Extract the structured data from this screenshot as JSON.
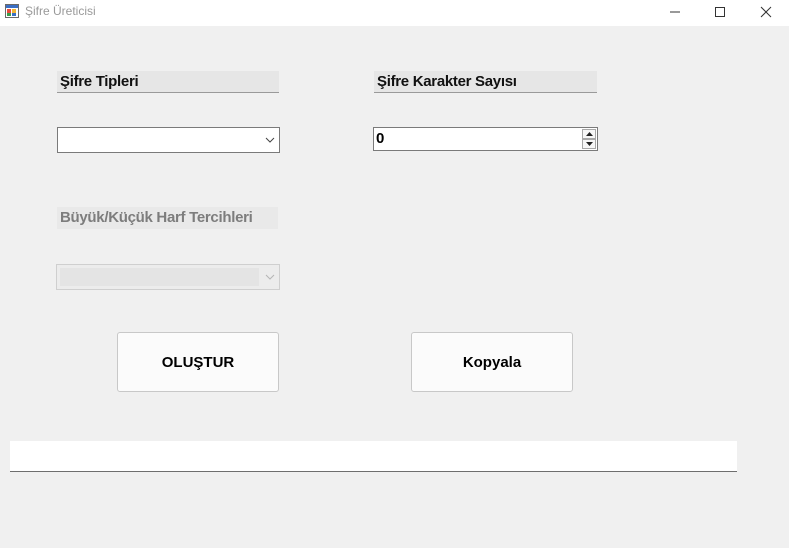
{
  "window": {
    "title": "Şifre Üreticisi"
  },
  "labels": {
    "password_types": "Şifre Tipleri",
    "char_count": "Şifre Karakter Sayısı",
    "case_preferences": "Büyük/Küçük Harf Tercihleri"
  },
  "inputs": {
    "password_type_value": "",
    "char_count_value": "0",
    "case_preference_value": "",
    "output_value": ""
  },
  "buttons": {
    "create": "OLUŞTUR",
    "copy": "Kopyala"
  },
  "icons": {
    "app": "app-window-icon",
    "minimize": "minimize-icon",
    "maximize": "maximize-icon",
    "close": "close-icon",
    "dropdown": "chevron-down-icon",
    "spin_up": "spin-up-icon",
    "spin_down": "spin-down-icon"
  },
  "colors": {
    "background": "#f0f0f0",
    "titlebar": "#ffffff",
    "disabled_text": "#7d7d7d"
  }
}
